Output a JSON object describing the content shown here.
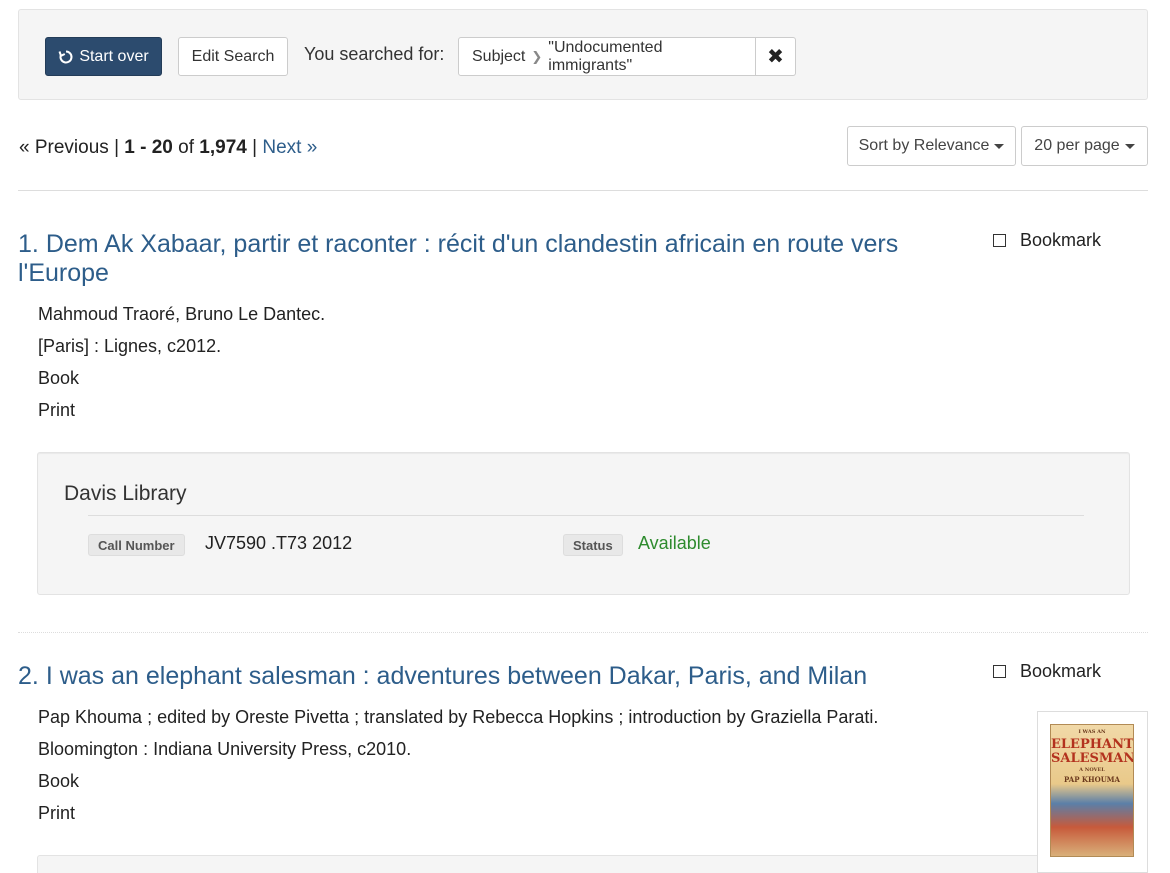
{
  "search": {
    "start_over": "Start over",
    "edit_search": "Edit Search",
    "you_searched_for": "You searched for:",
    "constraint_field": "Subject",
    "constraint_value": "\"Undocumented immigrants\""
  },
  "pagination": {
    "previous": "« Previous",
    "sep1": "|",
    "range": "1 - 20",
    "of": "of",
    "total": "1,974",
    "sep2": "|",
    "next": "Next »"
  },
  "controls": {
    "sort_label": "Sort by Relevance",
    "per_page_label": "20 per page"
  },
  "results": [
    {
      "number": "1.",
      "title_line1": "Dem Ak Xabaar, partir et raconter : récit d'un clandestin africain en route vers",
      "title_line2": "l'Europe",
      "bookmark": "Bookmark",
      "author": "Mahmoud Traoré, Bruno Le Dantec.",
      "publication": "[Paris] : Lignes, c2012.",
      "format": "Book",
      "medium": "Print",
      "holdings": {
        "library": "Davis Library",
        "call_number_label": "Call Number",
        "call_number": "JV7590 .T73 2012",
        "status_label": "Status",
        "status": "Available"
      }
    },
    {
      "number": "2.",
      "title": "I was an elephant salesman : adventures between Dakar, Paris, and Milan",
      "bookmark": "Bookmark",
      "author": "Pap Khouma ; edited by Oreste Pivetta ; translated by Rebecca Hopkins ; introduction by Graziella Parati.",
      "publication": "Bloomington : Indiana University Press, c2010.",
      "format": "Book",
      "medium": "Print",
      "cover": {
        "line1": "I WAS AN",
        "line2": "ELEPHANT",
        "line3": "SALESMAN",
        "line4": "A NOVEL",
        "line5": "PAP KHOUMA"
      }
    }
  ],
  "colors": {
    "primary": "#2c4b6e",
    "link": "#2d5d8a",
    "available": "#2e8b2e"
  }
}
